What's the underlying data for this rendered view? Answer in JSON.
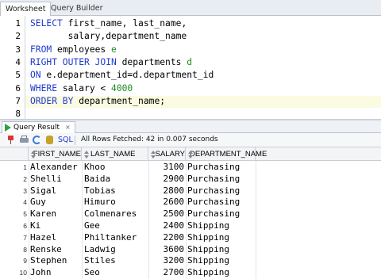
{
  "tabs": {
    "worksheet": "Worksheet",
    "query_builder": "Query Builder"
  },
  "editor": {
    "lines": [
      {
        "n": "1",
        "parts": [
          {
            "t": "SELECT",
            "c": "kw"
          },
          {
            "t": " first_name, last_name,",
            "c": ""
          }
        ]
      },
      {
        "n": "2",
        "parts": [
          {
            "t": "       salary,department_name",
            "c": ""
          }
        ]
      },
      {
        "n": "3",
        "parts": [
          {
            "t": "FROM",
            "c": "kw"
          },
          {
            "t": " employees ",
            "c": ""
          },
          {
            "t": "e",
            "c": "alias"
          }
        ]
      },
      {
        "n": "4",
        "parts": [
          {
            "t": "RIGHT OUTER JOIN",
            "c": "kw"
          },
          {
            "t": " departments ",
            "c": ""
          },
          {
            "t": "d",
            "c": "alias"
          }
        ]
      },
      {
        "n": "5",
        "parts": [
          {
            "t": "ON",
            "c": "kw"
          },
          {
            "t": " e.department_id=d.department_id",
            "c": ""
          }
        ]
      },
      {
        "n": "6",
        "parts": [
          {
            "t": "WHERE",
            "c": "kw"
          },
          {
            "t": " salary < ",
            "c": ""
          },
          {
            "t": "4000",
            "c": "num"
          }
        ]
      },
      {
        "n": "7",
        "parts": [
          {
            "t": "ORDER BY",
            "c": "kw"
          },
          {
            "t": " department_name;",
            "c": ""
          }
        ]
      },
      {
        "n": "8",
        "parts": []
      }
    ],
    "current_line": 6,
    "colors": {
      "keyword": "#1f3bd0",
      "number": "#1e8a1e",
      "current_line_bg": "#fbfbe2"
    }
  },
  "result": {
    "tab_label": "Query Result",
    "tab_icon": "play-icon",
    "close_label": "×",
    "sql_label": "SQL",
    "status": "All Rows Fetched: 42 in 0.007 seconds",
    "toolbar_icons": [
      "pin-icon",
      "print-icon",
      "refresh-icon",
      "database-icon"
    ]
  },
  "grid": {
    "columns": [
      "FIRST_NAME",
      "LAST_NAME",
      "SALARY",
      "DEPARTMENT_NAME"
    ],
    "rows": [
      [
        "1",
        "Alexander",
        "Khoo",
        "3100",
        "Purchasing"
      ],
      [
        "2",
        "Shelli",
        "Baida",
        "2900",
        "Purchasing"
      ],
      [
        "3",
        "Sigal",
        "Tobias",
        "2800",
        "Purchasing"
      ],
      [
        "4",
        "Guy",
        "Himuro",
        "2600",
        "Purchasing"
      ],
      [
        "5",
        "Karen",
        "Colmenares",
        "2500",
        "Purchasing"
      ],
      [
        "6",
        "Ki",
        "Gee",
        "2400",
        "Shipping"
      ],
      [
        "7",
        "Hazel",
        "Philtanker",
        "2200",
        "Shipping"
      ],
      [
        "8",
        "Renske",
        "Ladwig",
        "3600",
        "Shipping"
      ],
      [
        "9",
        "Stephen",
        "Stiles",
        "3200",
        "Shipping"
      ],
      [
        "10",
        "John",
        "Seo",
        "2700",
        "Shipping"
      ]
    ]
  }
}
